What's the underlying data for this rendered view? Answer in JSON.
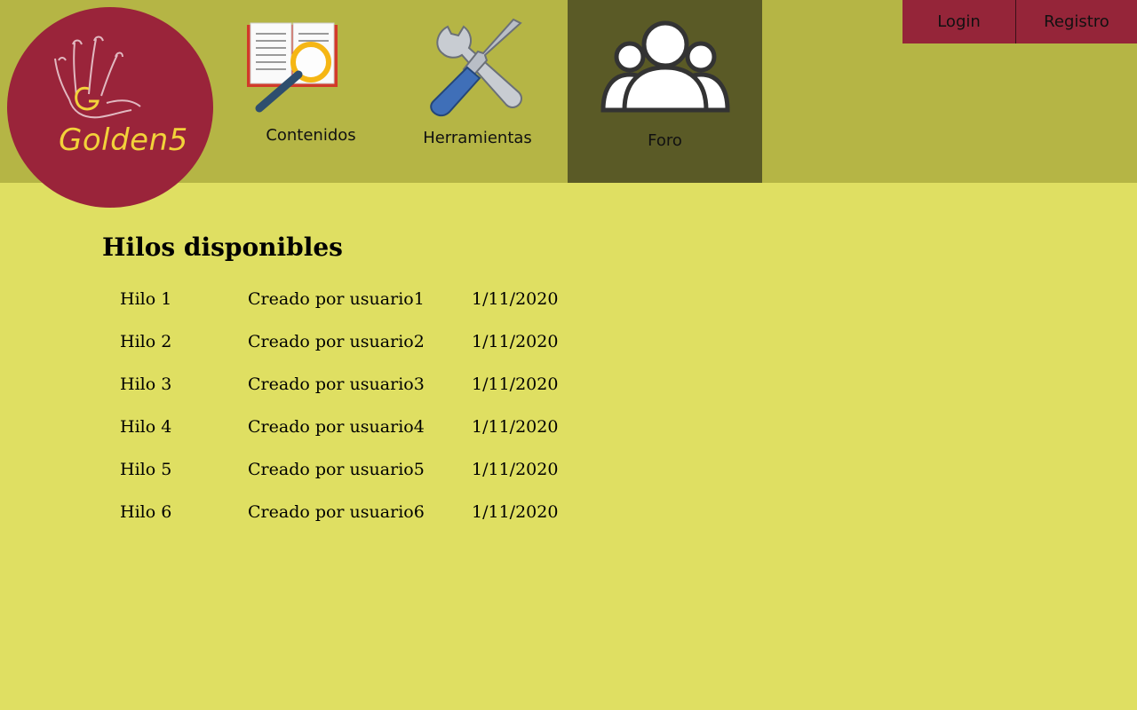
{
  "brand": {
    "name": "Golden5",
    "logo_icon": "hand-print-icon"
  },
  "nav": {
    "items": [
      {
        "label": "Contenidos",
        "icon": "book-magnifier-icon",
        "active": false
      },
      {
        "label": "Herramientas",
        "icon": "wrench-screwdriver-icon",
        "active": false
      },
      {
        "label": "Foro",
        "icon": "users-group-icon",
        "active": true
      }
    ]
  },
  "auth": {
    "login_label": "Login",
    "register_label": "Registro"
  },
  "forum": {
    "title": "Hilos disponibles",
    "threads": [
      {
        "name": "Hilo 1",
        "author": "Creado por usuario1",
        "date": "1/11/2020"
      },
      {
        "name": "Hilo 2",
        "author": "Creado por usuario2",
        "date": "1/11/2020"
      },
      {
        "name": "Hilo 3",
        "author": "Creado por usuario3",
        "date": "1/11/2020"
      },
      {
        "name": "Hilo 4",
        "author": "Creado por usuario4",
        "date": "1/11/2020"
      },
      {
        "name": "Hilo 5",
        "author": "Creado por usuario5",
        "date": "1/11/2020"
      },
      {
        "name": "Hilo 6",
        "author": "Creado por usuario6",
        "date": "1/11/2020"
      }
    ]
  },
  "colors": {
    "page_bg": "#dfdf62",
    "header_bg": "#b5b545",
    "active_nav_bg": "#5a5a26",
    "brand_red": "#952539",
    "brand_gold": "#f2d23a"
  }
}
